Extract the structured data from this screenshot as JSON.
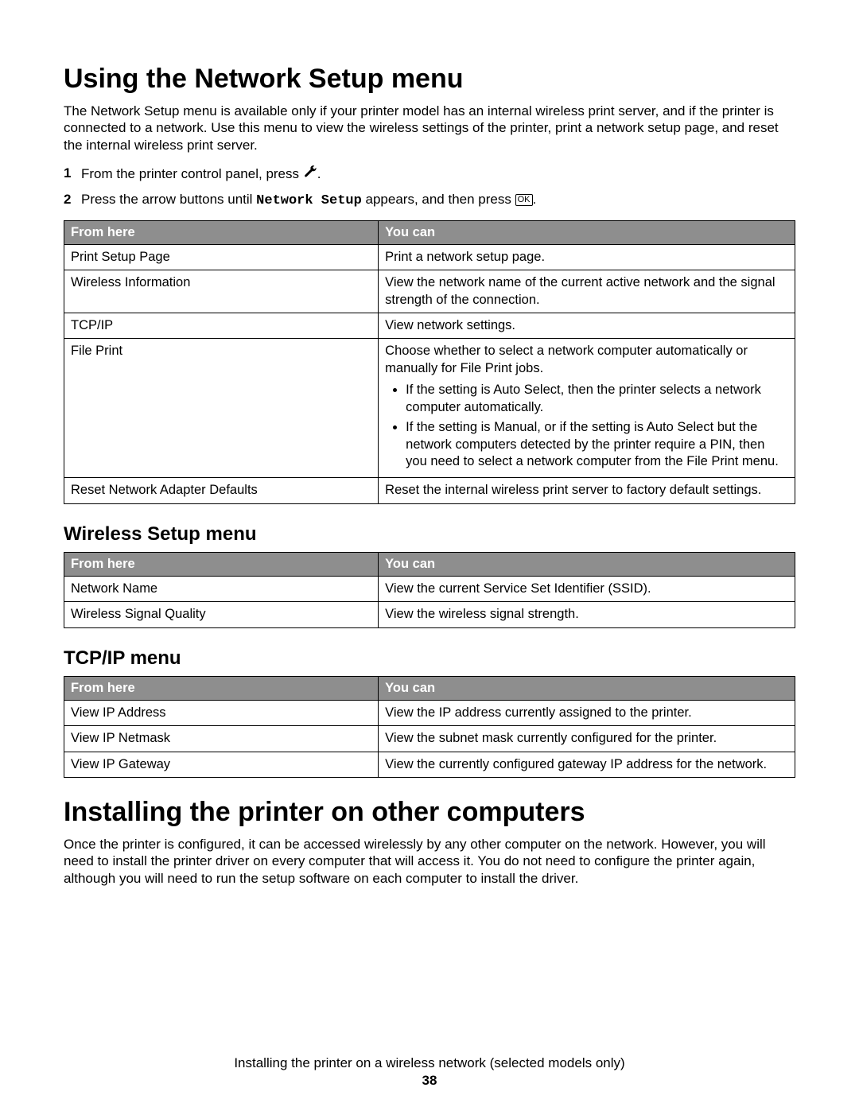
{
  "heading1": "Using the Network Setup menu",
  "intro1": "The Network Setup menu is available only if your printer model has an internal wireless print server, and if the printer is connected to a network. Use this menu to view the wireless settings of the printer, print a network setup page, and reset the internal wireless print server.",
  "step1_pre": "From the printer control panel, press ",
  "step2_pre": "Press the arrow buttons until ",
  "step2_mono": "Network Setup",
  "step2_post": " appears, and then press ",
  "ok_label": "OK",
  "table_headers": {
    "from": "From here",
    "you": "You can"
  },
  "network_table": [
    {
      "from": "Print Setup Page",
      "you": "Print a network setup page."
    },
    {
      "from": "Wireless Information",
      "you": "View the network name of the current active network and the signal strength of the connection."
    },
    {
      "from": "TCP/IP",
      "you": "View network settings."
    },
    {
      "from": "File Print",
      "you_lead": "Choose whether to select a network computer automatically or manually for File Print jobs.",
      "bullets": [
        "If the setting is Auto Select, then the printer selects a network computer automatically.",
        "If the setting is Manual, or if the setting is Auto Select but the network computers detected by the printer require a PIN, then you need to select a network computer from the File Print menu."
      ]
    },
    {
      "from": "Reset Network Adapter Defaults",
      "you": "Reset the internal wireless print server to factory default settings."
    }
  ],
  "heading_wireless": "Wireless Setup menu",
  "wireless_table": [
    {
      "from": "Network Name",
      "you": "View the current Service Set Identifier (SSID)."
    },
    {
      "from": "Wireless Signal Quality",
      "you": "View the wireless signal strength."
    }
  ],
  "heading_tcpip": "TCP/IP menu",
  "tcpip_table": [
    {
      "from": "View IP Address",
      "you": "View the IP address currently assigned to the printer."
    },
    {
      "from": "View IP Netmask",
      "you": "View the subnet mask currently configured for the printer."
    },
    {
      "from": "View IP Gateway",
      "you": "View the currently configured gateway IP address for the network."
    }
  ],
  "heading2": "Installing the printer on other computers",
  "intro2": "Once the printer is configured, it can be accessed wirelessly by any other computer on the network. However, you will need to install the printer driver on every computer that will access it. You do not need to configure the printer again, although you will need to run the setup software on each computer to install the driver.",
  "footer_chapter": "Installing the printer on a wireless network (selected models only)",
  "page_number": "38"
}
